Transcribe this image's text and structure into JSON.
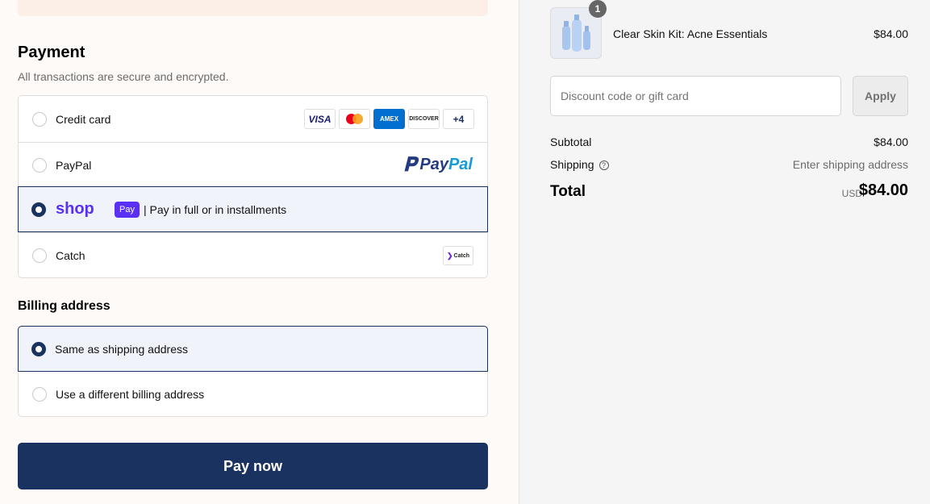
{
  "payment": {
    "title": "Payment",
    "subtitle": "All transactions are secure and encrypted.",
    "options": [
      {
        "label": "Credit card",
        "selected": false
      },
      {
        "label": "PayPal",
        "selected": false
      },
      {
        "label": "| Pay in full or in installments",
        "selected": true
      },
      {
        "label": "Catch",
        "selected": false
      }
    ],
    "card_brands": [
      "VISA",
      "AMEX",
      "DISCOVER",
      "+4"
    ],
    "paypal_logo": [
      "Pay",
      "Pal"
    ],
    "shop_pay_logo": {
      "word": "shop",
      "badge": "Pay"
    },
    "catch_logo": "Catch"
  },
  "billing": {
    "title": "Billing address",
    "options": [
      {
        "label": "Same as shipping address",
        "selected": true
      },
      {
        "label": "Use a different billing address",
        "selected": false
      }
    ]
  },
  "pay_button": "Pay now",
  "summary": {
    "product": {
      "name": "Clear Skin Kit: Acne Essentials",
      "price": "$84.00",
      "quantity": "1"
    },
    "discount": {
      "placeholder": "Discount code or gift card",
      "apply_label": "Apply"
    },
    "subtotal_label": "Subtotal",
    "subtotal_value": "$84.00",
    "shipping_label": "Shipping",
    "shipping_value": "Enter shipping address",
    "total_label": "Total",
    "currency": "USD",
    "total_value": "$84.00"
  },
  "colors": {
    "accent": "#1a3260",
    "shop_purple": "#5a31f4",
    "left_bg": "#fefaf7",
    "right_bg": "#f5f5f5"
  }
}
